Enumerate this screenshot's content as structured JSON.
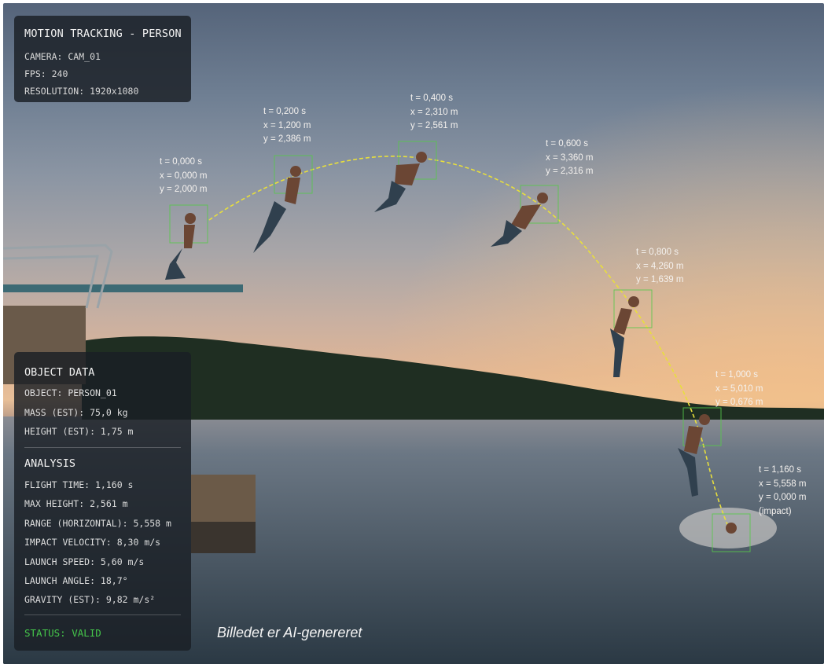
{
  "tracking_panel": {
    "title": "MOTION TRACKING - PERSON",
    "camera": "CAMERA: CAM_01",
    "fps": "FPS: 240",
    "resolution": "RESOLUTION: 1920x1080"
  },
  "object_panel": {
    "title": "OBJECT DATA",
    "object": "OBJECT: PERSON_01",
    "mass": "MASS (EST): 75,0 kg",
    "height": "HEIGHT (EST): 1,75 m"
  },
  "analysis_panel": {
    "title": "ANALYSIS",
    "flight_time": "FLIGHT TIME: 1,160 s",
    "max_height": "MAX HEIGHT: 2,561 m",
    "range": "RANGE (HORIZONTAL): 5,558 m",
    "impact_velocity": "IMPACT VELOCITY: 8,30 m/s",
    "launch_speed": "LAUNCH SPEED: 5,60 m/s",
    "launch_angle": "LAUNCH ANGLE: 18,7°",
    "gravity": "GRAVITY (EST): 9,82 m/s²",
    "status": "STATUS: VALID",
    "status_color": "#45c64a"
  },
  "frames": [
    {
      "t": "t = 0,000 s",
      "x": "x = 0,000 m",
      "y": "y = 2,000 m",
      "note": ""
    },
    {
      "t": "t = 0,200 s",
      "x": "x = 1,200 m",
      "y": "y = 2,386 m",
      "note": ""
    },
    {
      "t": "t = 0,400 s",
      "x": "x = 2,310 m",
      "y": "y = 2,561 m",
      "note": ""
    },
    {
      "t": "t = 0,600 s",
      "x": "x = 3,360 m",
      "y": "y = 2,316 m",
      "note": ""
    },
    {
      "t": "t = 0,800 s",
      "x": "x = 4,260 m",
      "y": "y = 1,639 m",
      "note": ""
    },
    {
      "t": "t = 1,000 s",
      "x": "x = 5,010 m",
      "y": "y = 0,676 m",
      "note": ""
    },
    {
      "t": "t = 1,160 s",
      "x": "x = 5,558 m",
      "y": "y = 0,000 m",
      "note": "(impact)"
    }
  ],
  "caption": "Billedet er AI-genereret",
  "colors": {
    "trajectory": "#e8df3c",
    "bounding_box": "#57c84a"
  }
}
